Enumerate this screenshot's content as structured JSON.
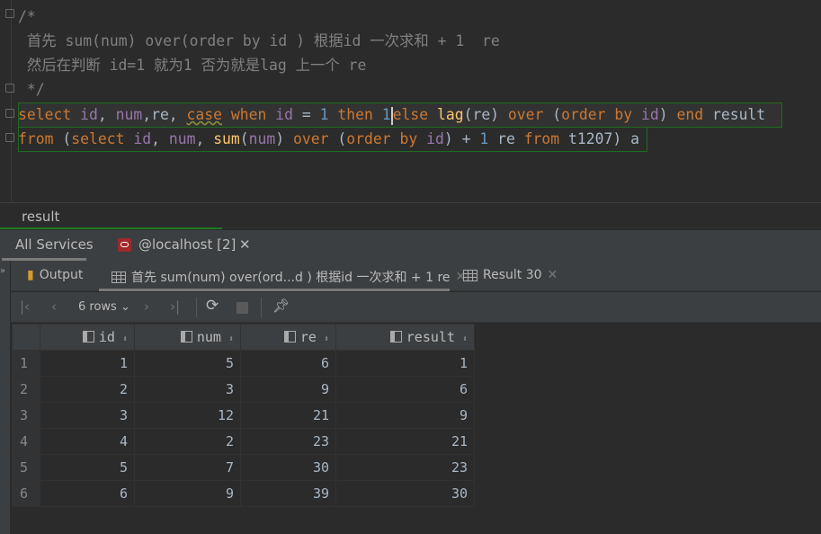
{
  "editor": {
    "comment_open": "/*",
    "comment_line1": " 首先 sum(num) over(order by id ) 根据id 一次求和 + 1  re",
    "comment_line2": " 然后在判断 id=1 就为1 否为就是lag 上一个 re",
    "comment_close": " */",
    "q1": [
      "select",
      " ",
      "id",
      ", ",
      "num",
      ",re, ",
      "case",
      " ",
      "when",
      " ",
      "id",
      " = ",
      "1",
      " ",
      "then",
      " ",
      "1",
      "",
      "else",
      " ",
      "lag",
      "(re) ",
      "over",
      " (",
      "order by",
      " ",
      "id",
      ") ",
      "end",
      " result"
    ],
    "q2": [
      "from",
      " (",
      "select",
      " ",
      "id",
      ", ",
      "num",
      ", ",
      "sum",
      "(",
      "num",
      ") ",
      "over",
      " (",
      "order by",
      " ",
      "id",
      ") + ",
      "1",
      " re ",
      "from",
      " t1207) a"
    ]
  },
  "result_label": "result",
  "services": {
    "all": "All Services",
    "conn": "@localhost [2]"
  },
  "result_tabs": {
    "output": "Output",
    "tab1": "首先 sum(num) over(ord...d ) 根据id 一次求和 + 1  re",
    "tab2": "Result 30"
  },
  "toolbar": {
    "rows": "6 rows"
  },
  "table": {
    "columns": [
      "id",
      "num",
      "re",
      "result"
    ],
    "rows": [
      [
        "1",
        "1",
        "5",
        "6",
        "1"
      ],
      [
        "2",
        "2",
        "3",
        "9",
        "6"
      ],
      [
        "3",
        "3",
        "12",
        "21",
        "9"
      ],
      [
        "4",
        "4",
        "2",
        "23",
        "21"
      ],
      [
        "5",
        "5",
        "7",
        "30",
        "23"
      ],
      [
        "6",
        "6",
        "9",
        "39",
        "30"
      ]
    ]
  },
  "colors": {
    "keyword": "#cc7832",
    "column": "#9876aa",
    "number": "#6897bb",
    "function": "#ffc66d",
    "comment": "#808080"
  }
}
